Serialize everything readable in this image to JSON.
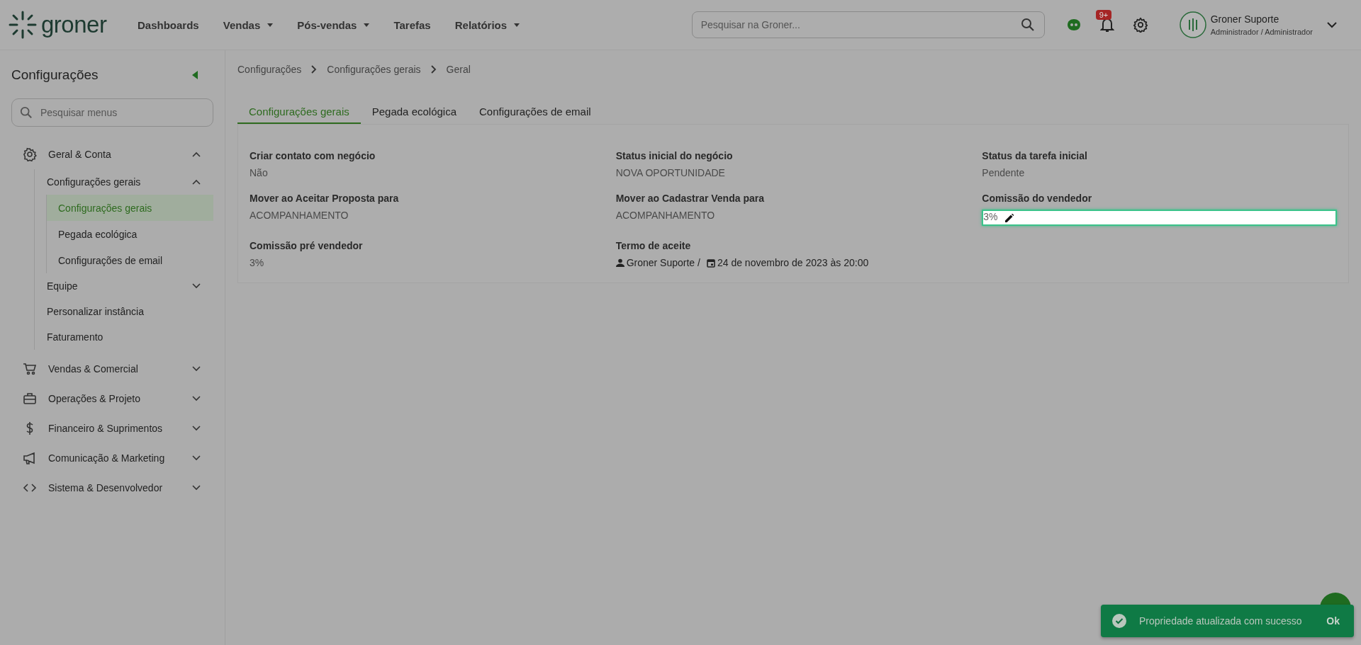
{
  "header": {
    "logo": "groner",
    "nav": [
      {
        "label": "Dashboards",
        "dropdown": false
      },
      {
        "label": "Vendas",
        "dropdown": true
      },
      {
        "label": "Pós-vendas",
        "dropdown": true
      },
      {
        "label": "Tarefas",
        "dropdown": false
      },
      {
        "label": "Relatórios",
        "dropdown": true
      }
    ],
    "search": {
      "placeholder": "Pesquisar na Groner..."
    },
    "notifications": "9+",
    "user": {
      "name": "Groner Suporte",
      "role": "Administrador / Administrador"
    }
  },
  "sidebar": {
    "title": "Configurações",
    "search": {
      "placeholder": "Pesquisar menus"
    },
    "groups": [
      {
        "label": "Geral & Conta",
        "expanded": true,
        "children": [
          {
            "label": "Configurações gerais",
            "kind": "folder",
            "expanded": true,
            "children": [
              {
                "label": "Configurações gerais",
                "selected": true
              },
              {
                "label": "Pegada ecológica",
                "selected": false
              },
              {
                "label": "Configurações de email",
                "selected": false
              }
            ]
          },
          {
            "label": "Equipe",
            "kind": "folder",
            "expanded": false
          },
          {
            "label": "Personalizar instância",
            "kind": "link"
          },
          {
            "label": "Faturamento",
            "kind": "link"
          }
        ]
      },
      {
        "label": "Vendas & Comercial",
        "expanded": false
      },
      {
        "label": "Operações & Projeto",
        "expanded": false
      },
      {
        "label": "Financeiro & Suprimentos",
        "expanded": false
      },
      {
        "label": "Comunicação & Marketing",
        "expanded": false
      },
      {
        "label": "Sistema & Desenvolvedor",
        "expanded": false
      }
    ]
  },
  "breadcrumb": [
    "Configurações",
    "Configurações gerais",
    "Geral"
  ],
  "tabs": [
    {
      "label": "Configurações gerais",
      "selected": true
    },
    {
      "label": "Pegada ecológica",
      "selected": false
    },
    {
      "label": "Configurações de email",
      "selected": false
    }
  ],
  "fields": [
    {
      "label": "Criar contato com negócio",
      "kind": "text",
      "value": "Não"
    },
    {
      "label": "Status inicial do negócio",
      "kind": "text",
      "value": "NOVA OPORTUNIDADE"
    },
    {
      "label": "Status da tarefa inicial",
      "kind": "text",
      "value": "Pendente"
    },
    {
      "label": "Mover ao Aceitar Proposta para",
      "kind": "text",
      "value": "ACOMPANHAMENTO"
    },
    {
      "label": "Mover ao Cadastrar Venda para",
      "kind": "text",
      "value": "ACOMPANHAMENTO"
    },
    {
      "label": "Comissão do vendedor",
      "kind": "editing",
      "value": "3%"
    },
    {
      "label": "Comissão pré vendedor",
      "kind": "text",
      "value": "3%"
    },
    {
      "label": "Termo de aceite",
      "kind": "signature",
      "user": "Groner Suporte /",
      "date": "24 de novembro de 2023 às 20:00"
    }
  ],
  "toast": {
    "message": "Propriedade atualizada com sucesso",
    "action": "Ok"
  }
}
